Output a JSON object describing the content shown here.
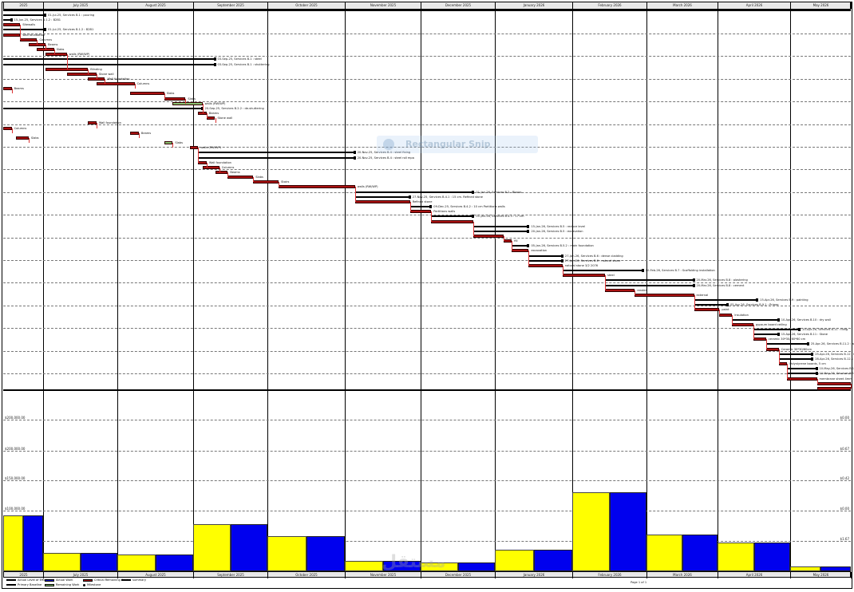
{
  "months": [
    "2025",
    "July 2025",
    "August 2025",
    "September 2025",
    "October 2025",
    "November 2025",
    "December 2025",
    "January 2026",
    "February 2026",
    "March 2026",
    "April 2026",
    "May 2026"
  ],
  "gantt_rows": [
    {
      "t": "black",
      "a": 0.0,
      "b": 0.05,
      "label": "01-Jul-25, Services B.1 : pouring"
    },
    {
      "t": "black",
      "a": 0.0,
      "b": 0.01,
      "label": "15-Jun-25, Services B.1.2 : B2B1"
    },
    {
      "t": "red",
      "a": 0.0,
      "b": 0.02,
      "label": "Sitewalls"
    },
    {
      "t": "black",
      "a": 0.0,
      "b": 0.05,
      "label": "01-Jul-25, Services B.1.2 : B2B1"
    },
    {
      "t": "red",
      "a": 0.0,
      "b": 0.02,
      "label": "Wall foundation"
    },
    {
      "t": "red",
      "a": 0.02,
      "b": 0.04,
      "label": "Columns"
    },
    {
      "t": "red",
      "a": 0.03,
      "b": 0.05,
      "label": "Beams"
    },
    {
      "t": "red",
      "a": 0.04,
      "b": 0.06,
      "label": "Slabs"
    },
    {
      "t": "red",
      "a": 0.05,
      "b": 0.075,
      "label": "walls (RW/WP)"
    },
    {
      "t": "black",
      "a": 0.0,
      "b": 0.25,
      "label": "03-Sep-25, Services B.1 : steel"
    },
    {
      "t": "black",
      "a": 0.0,
      "b": 0.25,
      "label": "03-Sep-25, Services B.1 : shuttering"
    },
    {
      "t": "red",
      "a": 0.05,
      "b": 0.1,
      "label": "Blinding"
    },
    {
      "t": "red",
      "a": 0.075,
      "b": 0.11,
      "label": "Stone wall"
    },
    {
      "t": "red",
      "a": 0.1,
      "b": 0.12,
      "label": "Wall foundation"
    },
    {
      "t": "red",
      "a": 0.11,
      "b": 0.155,
      "label": "Columns"
    },
    {
      "t": "red",
      "a": 0.0,
      "b": 0.01,
      "label": "Beams"
    },
    {
      "t": "red",
      "a": 0.15,
      "b": 0.19,
      "label": "Slabs"
    },
    {
      "t": "red",
      "a": 0.19,
      "b": 0.215,
      "label": "Slabs"
    },
    {
      "t": "green",
      "a": 0.2,
      "b": 0.235,
      "label": "walls (RW/WP)"
    },
    {
      "t": "black",
      "a": 0.0,
      "b": 0.235,
      "label": "20-Sep-25, Services B.2.2 : de-shuttering"
    },
    {
      "t": "red",
      "a": 0.23,
      "b": 0.24,
      "label": "Beams"
    },
    {
      "t": "red",
      "a": 0.24,
      "b": 0.25,
      "label": "Stone wall"
    },
    {
      "t": "red",
      "a": 0.1,
      "b": 0.11,
      "label": "Wall foundation"
    },
    {
      "t": "red",
      "a": 0.0,
      "b": 0.01,
      "label": "Columns"
    },
    {
      "t": "red",
      "a": 0.15,
      "b": 0.16,
      "label": "Beams"
    },
    {
      "t": "red",
      "a": 0.015,
      "b": 0.03,
      "label": "Slabs"
    },
    {
      "t": "green",
      "a": 0.19,
      "b": 0.2,
      "label": "Slabs"
    },
    {
      "t": "red",
      "a": 0.22,
      "b": 0.23,
      "label": "walls (RW/WP)"
    },
    {
      "t": "black",
      "a": 0.23,
      "b": 0.415,
      "label": "20-Nov-25, Services B.4 : steel fixing"
    },
    {
      "t": "black",
      "a": 0.23,
      "b": 0.415,
      "label": "20-Nov-25, Services B.4 : steel roll mpa"
    },
    {
      "t": "red",
      "a": 0.23,
      "b": 0.24,
      "label": "Wall foundation"
    },
    {
      "t": "red",
      "a": 0.235,
      "b": 0.255,
      "label": "Columns"
    },
    {
      "t": "red",
      "a": 0.25,
      "b": 0.265,
      "label": "Beams"
    },
    {
      "t": "red",
      "a": 0.265,
      "b": 0.295,
      "label": "Slabs"
    },
    {
      "t": "red",
      "a": 0.295,
      "b": 0.325,
      "label": "Stairs"
    },
    {
      "t": "red",
      "a": 0.325,
      "b": 0.415,
      "label": "walls (RW/WP)"
    },
    {
      "t": "black",
      "a": 0.415,
      "b": 0.555,
      "label": "01-Jan-26, Services B.2 : Blocks"
    },
    {
      "t": "black",
      "a": 0.415,
      "b": 0.48,
      "label": "27-Nov-25, Services B.4.1 : 15 cm. Refined stone"
    },
    {
      "t": "red",
      "a": 0.415,
      "b": 0.48,
      "label": "Refined stone"
    },
    {
      "t": "black",
      "a": 0.48,
      "b": 0.505,
      "label": "09-Dec-25, Services B.4.2 : 10 cm Partitions walls"
    },
    {
      "t": "red",
      "a": 0.48,
      "b": 0.505,
      "label": "Partitions walls"
    },
    {
      "t": "black",
      "a": 0.505,
      "b": 0.555,
      "label": "01-Jan-26, Services B.4.3 : 17 cm"
    },
    {
      "t": "red",
      "a": 0.505,
      "b": 0.555,
      "label": ""
    },
    {
      "t": "black",
      "a": 0.555,
      "b": 0.62,
      "label": "15-Jan-26, Services B.5 : reduce level"
    },
    {
      "t": "black",
      "a": 0.555,
      "b": 0.62,
      "label": "20-Jan-26, Services B.5 : excavation"
    },
    {
      "t": "red",
      "a": 0.555,
      "b": 0.59,
      "label": ""
    },
    {
      "t": "red",
      "a": 0.59,
      "b": 0.6,
      "label": "fill"
    },
    {
      "t": "black",
      "a": 0.6,
      "b": 0.62,
      "label": "05-Jan-26, Services B.5.2 : main foundation"
    },
    {
      "t": "red",
      "a": 0.6,
      "b": 0.62,
      "label": "excavation"
    },
    {
      "t": "black",
      "a": 0.62,
      "b": 0.66,
      "label": "27-Jan-26, Services B.6 : dense cladding"
    },
    {
      "t": "black",
      "a": 0.62,
      "b": 0.66,
      "label": "27-Jan-26, Services B.6 : natural stone"
    },
    {
      "t": "red",
      "a": 0.62,
      "b": 0.66,
      "label": "natural stone 3/2 2076"
    },
    {
      "t": "black",
      "a": 0.66,
      "b": 0.755,
      "label": "10-Feb-26, Services B.7 : Scaffolding installation"
    },
    {
      "t": "red",
      "a": 0.66,
      "b": 0.71,
      "label": "steel"
    },
    {
      "t": "black",
      "a": 0.71,
      "b": 0.815,
      "label": "20-Mar-26, Services B.8 : plastering"
    },
    {
      "t": "black",
      "a": 0.71,
      "b": 0.815,
      "label": "20-Mar-26, Services B.8 : cement"
    },
    {
      "t": "red",
      "a": 0.71,
      "b": 0.745,
      "label": "render"
    },
    {
      "t": "red",
      "a": 0.745,
      "b": 0.815,
      "label": "external"
    },
    {
      "t": "black",
      "a": 0.815,
      "b": 0.89,
      "label": "15-Apr-26, Services B.9 : painting"
    },
    {
      "t": "black",
      "a": 0.815,
      "b": 0.855,
      "label": "05-Apr-26, Services B.9.1 : Primer"
    },
    {
      "t": "red",
      "a": 0.815,
      "b": 0.845,
      "label": "paint"
    },
    {
      "t": "red",
      "a": 0.845,
      "b": 0.86,
      "label": "Insulation"
    },
    {
      "t": "black",
      "a": 0.86,
      "b": 0.915,
      "label": "10-Apr-26, Services B.10 : dry wall"
    },
    {
      "t": "red",
      "a": 0.86,
      "b": 0.885,
      "label": "gypsum board ceiling"
    },
    {
      "t": "black",
      "a": 0.885,
      "b": 0.94,
      "label": "20-Apr-26, Services B.11 : tiling"
    },
    {
      "t": "black",
      "a": 0.885,
      "b": 0.915,
      "label": "15-Apr-26, Services B.11 : Stone"
    },
    {
      "t": "red",
      "a": 0.885,
      "b": 0.9,
      "label": "ceramic 30*30/ 60*60 cm"
    },
    {
      "t": "black",
      "a": 0.9,
      "b": 0.95,
      "label": "25-Apr-26, Services B.11.2 : walls, Bathroom"
    },
    {
      "t": "red",
      "a": 0.9,
      "b": 0.915,
      "label": "Ceramic 30*30/60cm"
    },
    {
      "t": "black",
      "a": 0.915,
      "b": 0.955,
      "label": "25-Apr-26, Services B.12 : thermal insulation"
    },
    {
      "t": "black",
      "a": 0.915,
      "b": 0.955,
      "label": "28-Apr-26, Services B.12.1 : floors"
    },
    {
      "t": "red",
      "a": 0.915,
      "b": 0.925,
      "label": "Polystyrene boards, 5 cm"
    },
    {
      "t": "black",
      "a": 0.925,
      "b": 0.96,
      "label": "10-May-26, Services B.13"
    },
    {
      "t": "black",
      "a": 0.925,
      "b": 0.96,
      "label": "10-May-26, Services B.13"
    },
    {
      "t": "red",
      "a": 0.925,
      "b": 0.96,
      "label": "membrane sheet 4mm"
    },
    {
      "t": "red",
      "a": 0.96,
      "b": 1.0,
      "label": ""
    },
    {
      "t": "red",
      "a": 0.96,
      "b": 1.0,
      "label": ""
    }
  ],
  "hist": {
    "y_labels": [
      "$200,000.00",
      "$200,000.00",
      "$150,000.00",
      "$100,000.00",
      "$50,000.00"
    ],
    "y2_labels": [
      "$0.00",
      "$0.67",
      "$0.42",
      "$0.00",
      "$1.67"
    ],
    "cost": [
      0.37,
      0.12,
      0.11,
      0.31,
      0.23,
      0.07,
      0.06,
      0.14,
      0.52,
      0.24,
      0.19,
      0.03
    ],
    "work": [
      0.37,
      0.12,
      0.11,
      0.31,
      0.23,
      0.07,
      0.06,
      0.14,
      0.52,
      0.24,
      0.19,
      0.03
    ]
  },
  "legend": [
    {
      "label": "Actual Level of Effort",
      "color": "#000000",
      "kind": "line"
    },
    {
      "label": "Actual Work",
      "color": "#0000cc",
      "kind": "box"
    },
    {
      "label": "Critical Remaining Work",
      "color": "#aa1111",
      "kind": "box"
    },
    {
      "label": "summary",
      "color": "#000000",
      "kind": "line"
    },
    {
      "label": "Primary Baseline",
      "color": "#000000",
      "kind": "line"
    },
    {
      "label": "Remaining Work",
      "color": "#88c070",
      "kind": "box"
    },
    {
      "label": "Milestone",
      "color": "#000000",
      "kind": "dot"
    }
  ],
  "footer": {
    "page": "Page 1 of 1"
  },
  "watermark": "Rectangular Snip",
  "watermark2": "مستقل",
  "colors": {
    "critical": "#aa1111",
    "baseline": "#000000",
    "cost": "#ffff00",
    "work": "#0000ee",
    "remaining": "#88c070"
  }
}
